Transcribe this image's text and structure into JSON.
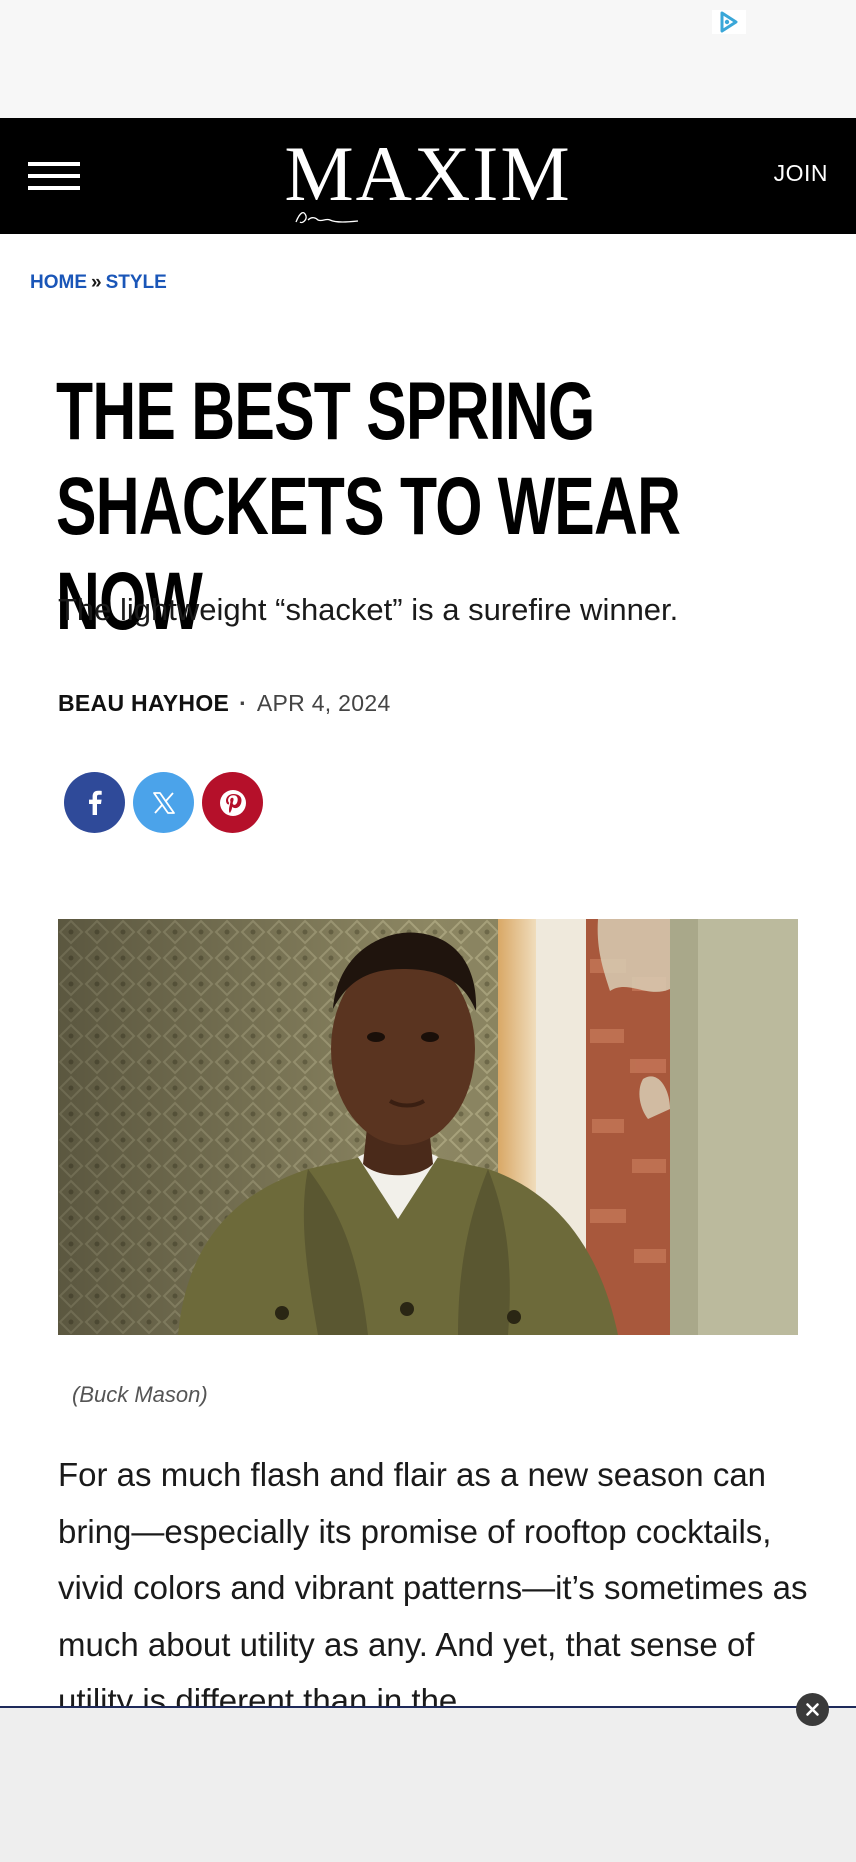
{
  "header": {
    "logo": "MAXIM",
    "join_label": "JOIN"
  },
  "breadcrumb": {
    "home": "HOME",
    "separator": "»",
    "section": "STYLE"
  },
  "article": {
    "headline_line1": "THE BEST SPRING",
    "headline_line2": "SHACKETS TO WEAR NOW",
    "dek": "The lightweight “shacket” is a surefire winner.",
    "author": "BEAU HAYHOE",
    "byline_separator": "·",
    "date": "APR 4, 2024",
    "image_caption": "(Buck Mason)",
    "body": "For as much flash and flair as a new season can bring—especially its promise of rooftop cocktails, vivid colors and vibrant patterns—it’s sometimes as much about utility as any. And yet, that sense of utility is different than in the"
  },
  "share": {
    "buttons": [
      "facebook-icon",
      "x-icon",
      "pinterest-icon"
    ],
    "colors": {
      "facebook": "#2f4a99",
      "x": "#4ba3ea",
      "pinterest": "#b5102a"
    }
  },
  "colors": {
    "header_bg": "#000000",
    "link_blue": "#1a56b8"
  }
}
